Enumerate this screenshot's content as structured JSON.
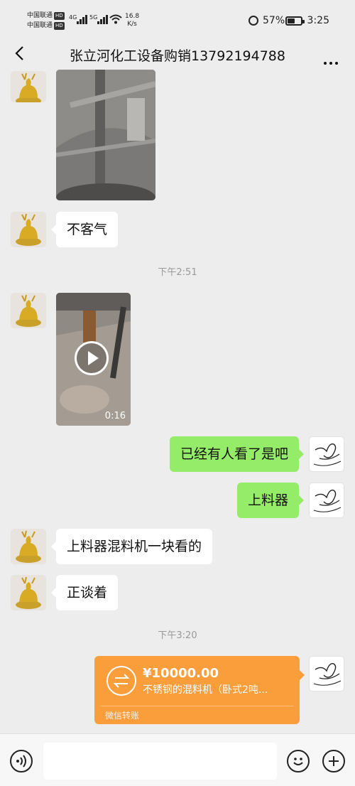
{
  "status_bar": {
    "carrier1": "中国联通",
    "carrier2": "中国联通",
    "hd": "HD",
    "network1": "4G",
    "network2": "5G",
    "speed_value": "16.8",
    "speed_unit": "K/s",
    "battery_percent": "57%",
    "battery_level": 0.57,
    "time": "3:25",
    "icons": [
      "alarm-icon",
      "wifi-icon",
      "signal-icon",
      "battery-icon"
    ]
  },
  "nav": {
    "title": "张立河化工设备购销13792194788",
    "back_icon": "chevron-left-icon",
    "more_icon": "more-dots-icon"
  },
  "messages": [
    {
      "type": "image",
      "from": "contact"
    },
    {
      "type": "text",
      "from": "contact",
      "text": "不客气"
    },
    {
      "type": "time",
      "text": "下午2:51"
    },
    {
      "type": "video",
      "from": "contact",
      "duration": "0:16"
    },
    {
      "type": "text",
      "from": "me",
      "text": "已经有人看了是吧"
    },
    {
      "type": "text",
      "from": "me",
      "text": "上料器"
    },
    {
      "type": "text",
      "from": "contact",
      "text": "上料器混料机一块看的"
    },
    {
      "type": "text",
      "from": "contact",
      "text": "正谈着"
    },
    {
      "type": "time",
      "text": "下午3:20"
    },
    {
      "type": "transfer",
      "from": "me",
      "amount": "¥10000.00",
      "note": "不锈钢的混料机（卧式2吨...",
      "label": "微信转账"
    }
  ],
  "input_bar": {
    "voice_icon": "voice-icon",
    "emoji_icon": "emoji-icon",
    "plus_icon": "plus-icon"
  },
  "colors": {
    "background": "#ededed",
    "outgoing_bubble": "#95ec69",
    "incoming_bubble": "#ffffff",
    "transfer_card": "#fa9d3b"
  }
}
